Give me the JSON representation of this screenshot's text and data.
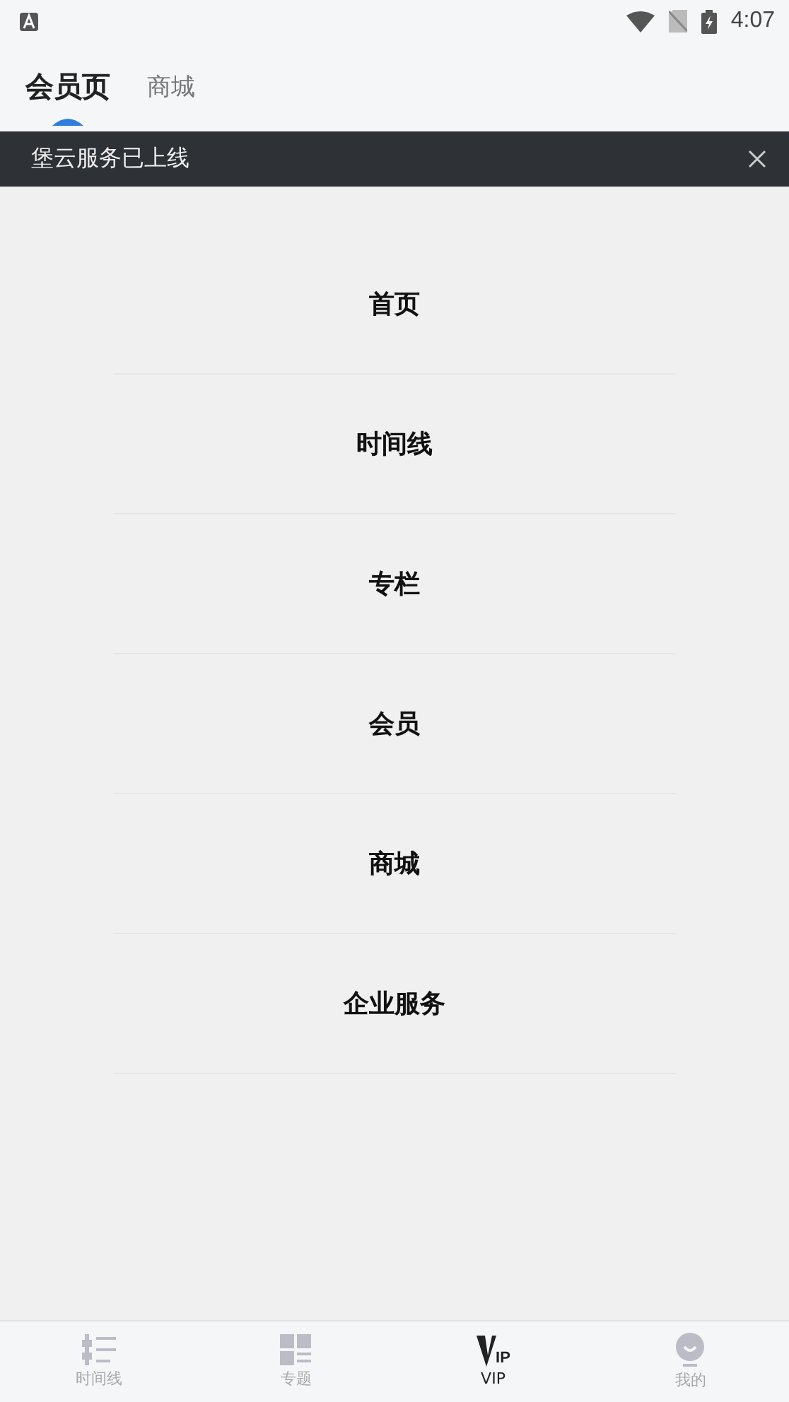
{
  "status_bar": {
    "time": "4:07"
  },
  "tabs": [
    {
      "label": "会员页",
      "selected": true
    },
    {
      "label": "商城",
      "selected": false
    }
  ],
  "banner": {
    "text": "堡云服务已上线"
  },
  "menu": [
    "首页",
    "时间线",
    "专栏",
    "会员",
    "商城",
    "企业服务"
  ],
  "bottom_nav": [
    {
      "kind": "timeline",
      "label": "时间线",
      "selected": false
    },
    {
      "kind": "topics",
      "label": "专题",
      "selected": false
    },
    {
      "kind": "vip",
      "label": "VIP",
      "badge": "IP",
      "selected": true
    },
    {
      "kind": "profile",
      "label": "我的",
      "selected": false
    }
  ]
}
